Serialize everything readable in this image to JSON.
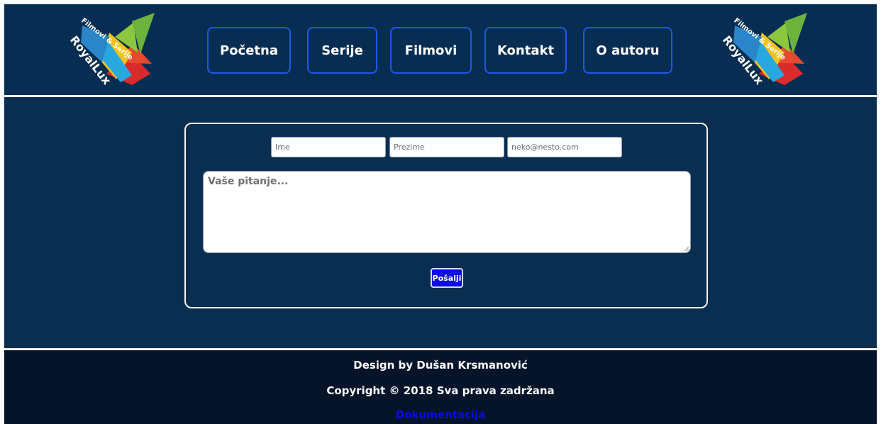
{
  "logo": {
    "text": "RoyalLux",
    "tagline": "Filmovi & Serije"
  },
  "nav": {
    "items": [
      "Početna",
      "Serije",
      "Filmovi",
      "Kontakt",
      "O autoru"
    ]
  },
  "form": {
    "first_name_placeholder": "Ime",
    "last_name_placeholder": "Prezime",
    "email_placeholder": "neko@nesto.com",
    "question_placeholder": "Vaše pitanje...",
    "submit_label": "Pošalji"
  },
  "footer": {
    "design": "Design by Dušan Krsmanović",
    "copyright": "Copyright © 2018 Sva prava zadržana",
    "docs_link": "Dokumentacija"
  },
  "colors": {
    "background": "#0a2e50",
    "footer_background": "#051428",
    "nav_border": "#1f57e8",
    "submit_button": "#0b0be6",
    "link": "#0a0af0"
  }
}
